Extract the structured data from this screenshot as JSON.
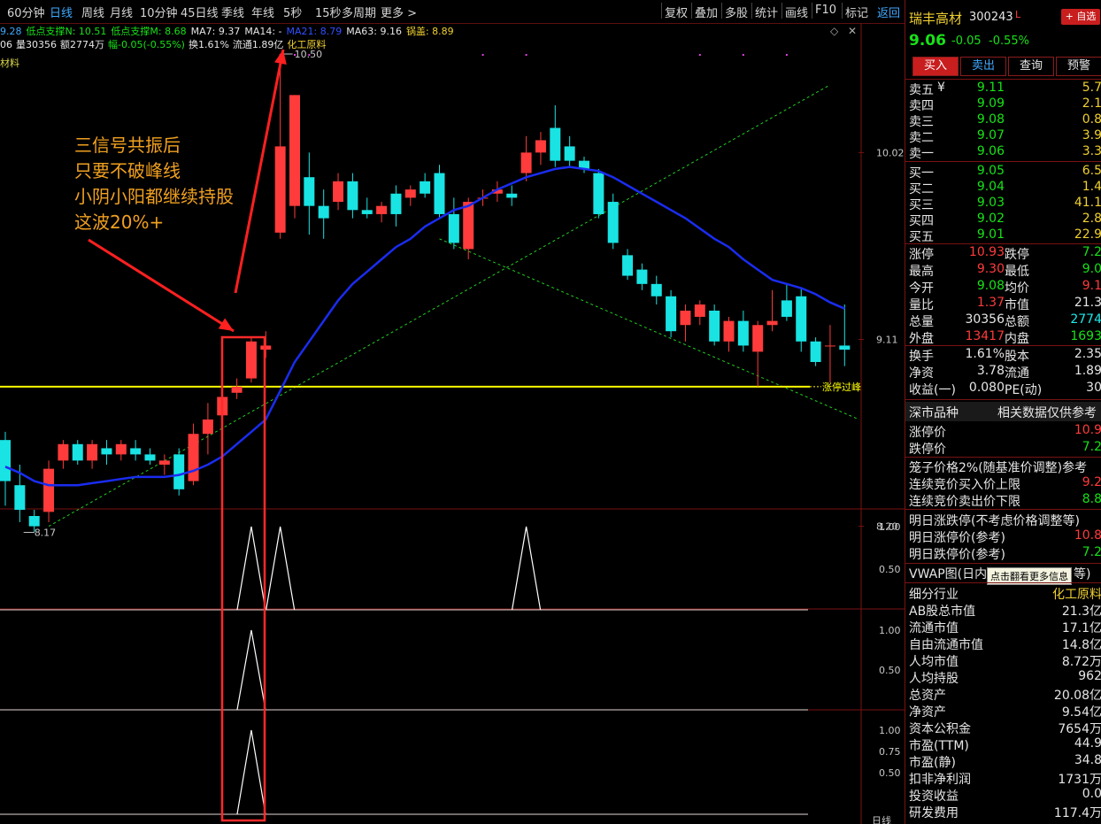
{
  "toolbar": {
    "items": [
      "60分钟",
      "日线",
      "周线",
      "月线",
      "10分钟",
      "45日线",
      "季线",
      "年线",
      "5秒",
      "15秒",
      "多周期",
      "更多 >"
    ],
    "active": "日线",
    "right_items": [
      "复权",
      "叠加",
      "多股",
      "统计",
      "画线",
      "F10",
      "标记"
    ],
    "return_label": "返回"
  },
  "indicators": {
    "line1": [
      {
        "text": "9.28",
        "color": "#3fa9ff"
      },
      {
        "text": "低点支撑N: 10.51",
        "color": "#18e218"
      },
      {
        "text": "低点支撑M: 8.68",
        "color": "#18e218"
      },
      {
        "text": "MA7: 9.37",
        "color": "#e6e6e6"
      },
      {
        "text": "MA14: -",
        "color": "#e6e6e6"
      },
      {
        "text": "MA21: 8.79",
        "color": "#3050ff"
      },
      {
        "text": "MA63: 9.16",
        "color": "#e6e6e6"
      },
      {
        "text": "锅盖: 8.89",
        "color": "#f0d030"
      }
    ],
    "line2": [
      {
        "text": "06",
        "color": "#e6e6e6"
      },
      {
        "text": "量30356",
        "color": "#e6e6e6"
      },
      {
        "text": "额2774万",
        "color": "#e6e6e6"
      },
      {
        "text": "幅-0.05(-0.55%)",
        "color": "#18e218"
      },
      {
        "text": "换1.61%",
        "color": "#e6e6e6"
      },
      {
        "text": "流通1.89亿",
        "color": "#e6e6e6"
      },
      {
        "text": "化工原料",
        "color": "#f0d030"
      }
    ],
    "sub_label": "材料",
    "diamond": "◇",
    "close_x": "✕"
  },
  "annotation": {
    "lines": [
      "三信号共振后",
      "只要不破峰线",
      "小阴小阳都继续持股",
      "这波20%+"
    ]
  },
  "chart_data": {
    "type": "candlestick",
    "price_axis_labels": [
      "10.02",
      "9.11",
      "8.20"
    ],
    "high_label": "10.50",
    "low_label": "8.17",
    "limit_line_label": "涨停过峰",
    "candles": [
      {
        "o": 8.62,
        "h": 8.66,
        "l": 8.3,
        "c": 8.42
      },
      {
        "o": 8.4,
        "h": 8.5,
        "l": 8.22,
        "c": 8.28
      },
      {
        "o": 8.25,
        "h": 8.28,
        "l": 8.17,
        "c": 8.2
      },
      {
        "o": 8.27,
        "h": 8.52,
        "l": 8.22,
        "c": 8.48
      },
      {
        "o": 8.52,
        "h": 8.62,
        "l": 8.48,
        "c": 8.6
      },
      {
        "o": 8.6,
        "h": 8.62,
        "l": 8.5,
        "c": 8.52
      },
      {
        "o": 8.52,
        "h": 8.62,
        "l": 8.48,
        "c": 8.6
      },
      {
        "o": 8.58,
        "h": 8.62,
        "l": 8.5,
        "c": 8.55
      },
      {
        "o": 8.55,
        "h": 8.62,
        "l": 8.52,
        "c": 8.6
      },
      {
        "o": 8.58,
        "h": 8.62,
        "l": 8.52,
        "c": 8.55
      },
      {
        "o": 8.55,
        "h": 8.58,
        "l": 8.5,
        "c": 8.52
      },
      {
        "o": 8.5,
        "h": 8.55,
        "l": 8.45,
        "c": 8.52
      },
      {
        "o": 8.55,
        "h": 8.58,
        "l": 8.35,
        "c": 8.38
      },
      {
        "o": 8.42,
        "h": 8.7,
        "l": 8.4,
        "c": 8.65
      },
      {
        "o": 8.65,
        "h": 8.8,
        "l": 8.55,
        "c": 8.72
      },
      {
        "o": 8.74,
        "h": 8.86,
        "l": 8.68,
        "c": 8.83
      },
      {
        "o": 8.85,
        "h": 8.92,
        "l": 8.82,
        "c": 8.88
      },
      {
        "o": 8.92,
        "h": 9.12,
        "l": 8.9,
        "c": 9.1
      },
      {
        "o": 9.06,
        "h": 9.15,
        "l": 9.02,
        "c": 9.08
      },
      {
        "o": 9.63,
        "h": 10.5,
        "l": 9.6,
        "c": 10.05
      },
      {
        "o": 9.76,
        "h": 10.3,
        "l": 9.7,
        "c": 10.3
      },
      {
        "o": 9.9,
        "h": 10.02,
        "l": 9.62,
        "c": 9.76
      },
      {
        "o": 9.76,
        "h": 9.84,
        "l": 9.6,
        "c": 9.7
      },
      {
        "o": 9.78,
        "h": 9.92,
        "l": 9.74,
        "c": 9.88
      },
      {
        "o": 9.88,
        "h": 9.92,
        "l": 9.7,
        "c": 9.74
      },
      {
        "o": 9.74,
        "h": 9.8,
        "l": 9.7,
        "c": 9.72
      },
      {
        "o": 9.72,
        "h": 9.78,
        "l": 9.68,
        "c": 9.76
      },
      {
        "o": 9.82,
        "h": 9.86,
        "l": 9.66,
        "c": 9.72
      },
      {
        "o": 9.8,
        "h": 9.86,
        "l": 9.76,
        "c": 9.84
      },
      {
        "o": 9.88,
        "h": 9.92,
        "l": 9.8,
        "c": 9.82
      },
      {
        "o": 9.92,
        "h": 9.96,
        "l": 9.7,
        "c": 9.72
      },
      {
        "o": 9.72,
        "h": 9.8,
        "l": 9.55,
        "c": 9.58
      },
      {
        "o": 9.55,
        "h": 9.8,
        "l": 9.5,
        "c": 9.78
      },
      {
        "o": 9.8,
        "h": 9.84,
        "l": 9.76,
        "c": 9.8
      },
      {
        "o": 9.82,
        "h": 9.88,
        "l": 9.78,
        "c": 9.84
      },
      {
        "o": 9.82,
        "h": 9.86,
        "l": 9.76,
        "c": 9.8
      },
      {
        "o": 9.92,
        "h": 10.1,
        "l": 9.88,
        "c": 10.02
      },
      {
        "o": 10.02,
        "h": 10.12,
        "l": 9.96,
        "c": 10.08
      },
      {
        "o": 10.14,
        "h": 10.25,
        "l": 9.95,
        "c": 9.98
      },
      {
        "o": 10.05,
        "h": 10.1,
        "l": 9.95,
        "c": 9.98
      },
      {
        "o": 9.98,
        "h": 10.0,
        "l": 9.92,
        "c": 9.94
      },
      {
        "o": 9.92,
        "h": 9.94,
        "l": 9.7,
        "c": 9.72
      },
      {
        "o": 9.78,
        "h": 9.82,
        "l": 9.55,
        "c": 9.58
      },
      {
        "o": 9.52,
        "h": 9.55,
        "l": 9.4,
        "c": 9.42
      },
      {
        "o": 9.45,
        "h": 9.48,
        "l": 9.35,
        "c": 9.38
      },
      {
        "o": 9.38,
        "h": 9.42,
        "l": 9.28,
        "c": 9.32
      },
      {
        "o": 9.32,
        "h": 9.35,
        "l": 9.12,
        "c": 9.15
      },
      {
        "o": 9.18,
        "h": 9.28,
        "l": 9.1,
        "c": 9.25
      },
      {
        "o": 9.22,
        "h": 9.3,
        "l": 9.18,
        "c": 9.28
      },
      {
        "o": 9.25,
        "h": 9.28,
        "l": 9.08,
        "c": 9.1
      },
      {
        "o": 9.1,
        "h": 9.22,
        "l": 9.05,
        "c": 9.2
      },
      {
        "o": 9.2,
        "h": 9.25,
        "l": 9.05,
        "c": 9.08
      },
      {
        "o": 9.05,
        "h": 9.2,
        "l": 8.88,
        "c": 9.18
      },
      {
        "o": 9.18,
        "h": 9.35,
        "l": 9.15,
        "c": 9.2
      },
      {
        "o": 9.3,
        "h": 9.38,
        "l": 9.2,
        "c": 9.22
      },
      {
        "o": 9.32,
        "h": 9.36,
        "l": 9.05,
        "c": 9.1
      },
      {
        "o": 9.1,
        "h": 9.12,
        "l": 8.98,
        "c": 9.0
      },
      {
        "o": 9.08,
        "h": 9.18,
        "l": 8.9,
        "c": 9.08
      },
      {
        "o": 9.08,
        "h": 9.28,
        "l": 8.98,
        "c": 9.06
      }
    ],
    "ma_blue": [
      8.49,
      8.46,
      8.42,
      8.4,
      8.4,
      8.4,
      8.41,
      8.42,
      8.43,
      8.44,
      8.44,
      8.44,
      8.45,
      8.47,
      8.5,
      8.54,
      8.6,
      8.66,
      8.72,
      8.86,
      9.0,
      9.1,
      9.2,
      9.3,
      9.38,
      9.44,
      9.5,
      9.56,
      9.6,
      9.66,
      9.7,
      9.74,
      9.76,
      9.8,
      9.84,
      9.87,
      9.9,
      9.92,
      9.94,
      9.95,
      9.94,
      9.93,
      9.9,
      9.86,
      9.82,
      9.78,
      9.74,
      9.7,
      9.65,
      9.6,
      9.56,
      9.5,
      9.45,
      9.4,
      9.38,
      9.36,
      9.33,
      9.29,
      9.26
    ],
    "support_dash_up": {
      "from_index": 3,
      "from": 8.2,
      "to_index": 57,
      "to": 10.35
    },
    "support_dash_down": {
      "from_index": 30,
      "from": 9.6,
      "to_index": 59,
      "to": 8.72
    },
    "limit_line_price": 8.88,
    "sub_charts": [
      {
        "axis_labels": [
          "1.00",
          "0.50"
        ],
        "signal_indices": [
          17,
          19,
          36
        ]
      },
      {
        "axis_labels": [
          "1.00",
          "0.50"
        ],
        "signal_indices": [
          17
        ]
      },
      {
        "axis_labels": [
          "1.00",
          "0.75",
          "0.50"
        ],
        "signal_indices": [
          17
        ]
      }
    ]
  },
  "right_panel": {
    "stock_name": "瑞丰高材",
    "stock_code": "300243",
    "stock_flag": "L",
    "watch_button": "+ 自选",
    "price": "9.06",
    "change": "-0.05",
    "change_pct": "-0.55%",
    "actions": [
      "买入",
      "卖出",
      "查询",
      "预警"
    ],
    "asks": [
      {
        "label": "卖五",
        "p": "9.11",
        "v": "5.7"
      },
      {
        "label": "卖四",
        "p": "9.09",
        "v": "2.1"
      },
      {
        "label": "卖三",
        "p": "9.08",
        "v": "0.8"
      },
      {
        "label": "卖二",
        "p": "9.07",
        "v": "3.9"
      },
      {
        "label": "卖一",
        "p": "9.06",
        "v": "3.3"
      }
    ],
    "ask_marker": "¥",
    "bids": [
      {
        "label": "买一",
        "p": "9.05",
        "v": "6.5"
      },
      {
        "label": "买二",
        "p": "9.04",
        "v": "1.4"
      },
      {
        "label": "买三",
        "p": "9.03",
        "v": "41.1"
      },
      {
        "label": "买四",
        "p": "9.02",
        "v": "2.8"
      },
      {
        "label": "买五",
        "p": "9.01",
        "v": "22.9"
      }
    ],
    "stats": [
      {
        "l": "涨停",
        "v": "10.93",
        "vc": "red",
        "l2": "跌停",
        "v2": "7.2",
        "v2c": "green"
      },
      {
        "l": "最高",
        "v": "9.30",
        "vc": "red",
        "l2": "最低",
        "v2": "9.0",
        "v2c": "green"
      },
      {
        "l": "今开",
        "v": "9.08",
        "vc": "green",
        "l2": "均价",
        "v2": "9.1",
        "v2c": "red"
      },
      {
        "l": "量比",
        "v": "1.37",
        "vc": "red",
        "l2": "市值",
        "v2": "21.3",
        "v2c": "white"
      },
      {
        "l": "总量",
        "v": "30356",
        "vc": "white",
        "l2": "总额",
        "v2": "2774",
        "v2c": "cyan"
      },
      {
        "l": "外盘",
        "v": "13417",
        "vc": "red",
        "l2": "内盘",
        "v2": "1693",
        "v2c": "green"
      }
    ],
    "stats2": [
      {
        "l": "换手",
        "v": "1.61%",
        "l2": "股本",
        "v2": "2.35"
      },
      {
        "l": "净资",
        "v": "3.78",
        "l2": "流通",
        "v2": "1.89"
      },
      {
        "l": "收益(一)",
        "v": "0.080",
        "l2": "PE(动)",
        "v2": "30"
      }
    ],
    "section_title": "深市品种",
    "section_note": "相关数据仅供参考",
    "limit_rows": [
      {
        "l": "涨停价",
        "v": "10.9",
        "vc": "red"
      },
      {
        "l": "跌停价",
        "v": "7.2",
        "vc": "green"
      }
    ],
    "cage_rows": [
      {
        "l": "笼子价格2%(随基准价调整)参考",
        "v": "",
        "vc": "white"
      },
      {
        "l": "连续竞价买入价上限",
        "v": "9.2",
        "vc": "red"
      },
      {
        "l": "连续竞价卖出价下限",
        "v": "8.8",
        "vc": "green"
      }
    ],
    "tomorrow_rows": [
      {
        "l": "明日涨跌停(不考虑价格调整等)",
        "v": "",
        "vc": "white"
      },
      {
        "l": "明日涨停价(参考)",
        "v": "10.8",
        "vc": "red"
      },
      {
        "l": "明日跌停价(参考)",
        "v": "7.2",
        "vc": "green"
      }
    ],
    "vwap_label": "VWAP图(日内",
    "vwap_tail": "等)",
    "tooltip": "点击翻看更多信息",
    "info_rows": [
      {
        "l": "细分行业",
        "v": "化工原料",
        "vc": "yellow"
      },
      {
        "l": "AB股总市值",
        "v": "21.3亿",
        "vc": "white"
      },
      {
        "l": "流通市值",
        "v": "17.1亿",
        "vc": "white"
      },
      {
        "l": "自由流通市值",
        "v": "14.8亿",
        "vc": "white"
      },
      {
        "l": "人均市值",
        "v": "8.72万",
        "vc": "white"
      },
      {
        "l": "人均持股",
        "v": "962",
        "vc": "white"
      },
      {
        "l": "总资产",
        "v": "20.08亿",
        "vc": "white"
      },
      {
        "l": "净资产",
        "v": "9.54亿",
        "vc": "white"
      },
      {
        "l": "资本公积金",
        "v": "7654万",
        "vc": "white"
      },
      {
        "l": "市盈(TTM)",
        "v": "44.9",
        "vc": "white"
      },
      {
        "l": "市盈(静)",
        "v": "34.8",
        "vc": "white"
      },
      {
        "l": "扣非净利润",
        "v": "1731万",
        "vc": "white"
      },
      {
        "l": "投资收益",
        "v": "0.0",
        "vc": "white"
      },
      {
        "l": "研发费用",
        "v": "117.4万",
        "vc": "white"
      }
    ],
    "bottom_tab": "日线"
  },
  "colors": {
    "up": "#ff3b3b",
    "down": "#19e3e3",
    "ma": "#1a2cf0",
    "support": "#22cc22",
    "limit": "#ffff00",
    "frame": "#ff2a2a"
  }
}
